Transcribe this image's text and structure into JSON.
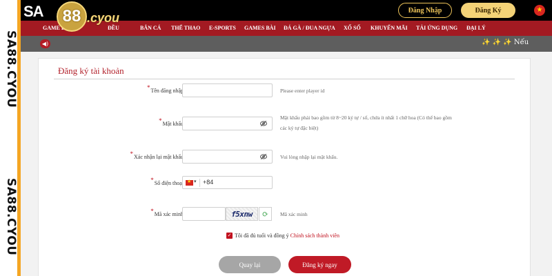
{
  "watermark": "SA88.CYOU",
  "header": {
    "logo_sa": "SA",
    "logo_88": "88",
    "logo_cyou": ".cyou",
    "login_label": "Đăng Nhập",
    "register_label": "Đăng Ký",
    "language_icon": "vietnam-flag-icon"
  },
  "nav": {
    "items": [
      "GAME B",
      "ĐỀU",
      "BẮN CÁ",
      "THỂ THAO",
      "E-SPORTS",
      "GAMES BÀI",
      "ĐÁ GÀ / ĐUA NGỰA",
      "XỔ SỐ",
      "KHUYẾN MÃI",
      "TẢI ỨNG DỤNG",
      "ĐẠI LÝ"
    ]
  },
  "marquee": {
    "icon": "speaker-icon",
    "stars": "✨ ✨ ✨",
    "text": "Nếu"
  },
  "form": {
    "title": "Đăng ký tài khoản",
    "username": {
      "label": "Tên đăng nhập",
      "value": "",
      "hint": "Please enter player id"
    },
    "password": {
      "label": "Mật khẩu",
      "value": "",
      "hint": "Mật khẩu phải bao gồm từ 8~20 ký tự / số, chứa ít nhất 1 chữ hoa (Có thể bao gồm các ký tự đặc biệt)"
    },
    "confirm": {
      "label": "Xác nhận lại mật khẩu",
      "value": "",
      "hint": "Vui lòng nhập lại mật khẩu."
    },
    "phone": {
      "label": "Số điện thoại",
      "country_code": "+84",
      "value": ""
    },
    "captcha": {
      "label": "Mã xác minh",
      "value": "",
      "image_text": "f5xnw",
      "hint": "Mã xác minh"
    },
    "agree": {
      "text": "Tôi đã đủ tuổi và đồng ý",
      "policy": "Chính sách thành viên",
      "checked": true
    },
    "back_label": "Quay lại",
    "submit_label": "Đăng ký ngay"
  },
  "colors": {
    "brand_red": "#a31a22",
    "accent_gold": "#f3d277",
    "button_red": "#c01a26"
  }
}
